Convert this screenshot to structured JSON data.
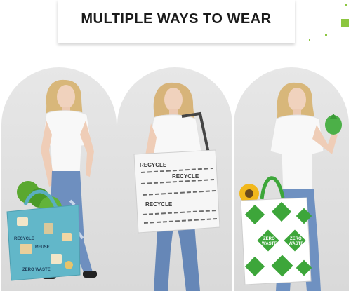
{
  "banner": {
    "title": "MULTIPLE WAYS TO WEAR"
  },
  "colors": {
    "accent_green": "#8cc63f",
    "arch_bg": "#e0e0e0",
    "bag_teal": "#62b7c9",
    "bag_green": "#3da63a"
  },
  "panels": [
    {
      "bag": {
        "print_words": [
          "RECYCLE",
          "REUSE",
          "ZERO WASTE"
        ]
      }
    },
    {
      "bag": {
        "print_words": [
          "RECYCLE",
          "RECYCLE",
          "RECYCLE"
        ]
      }
    },
    {
      "bag": {
        "print_words": [
          "ZERO",
          "WASTE"
        ]
      }
    }
  ]
}
